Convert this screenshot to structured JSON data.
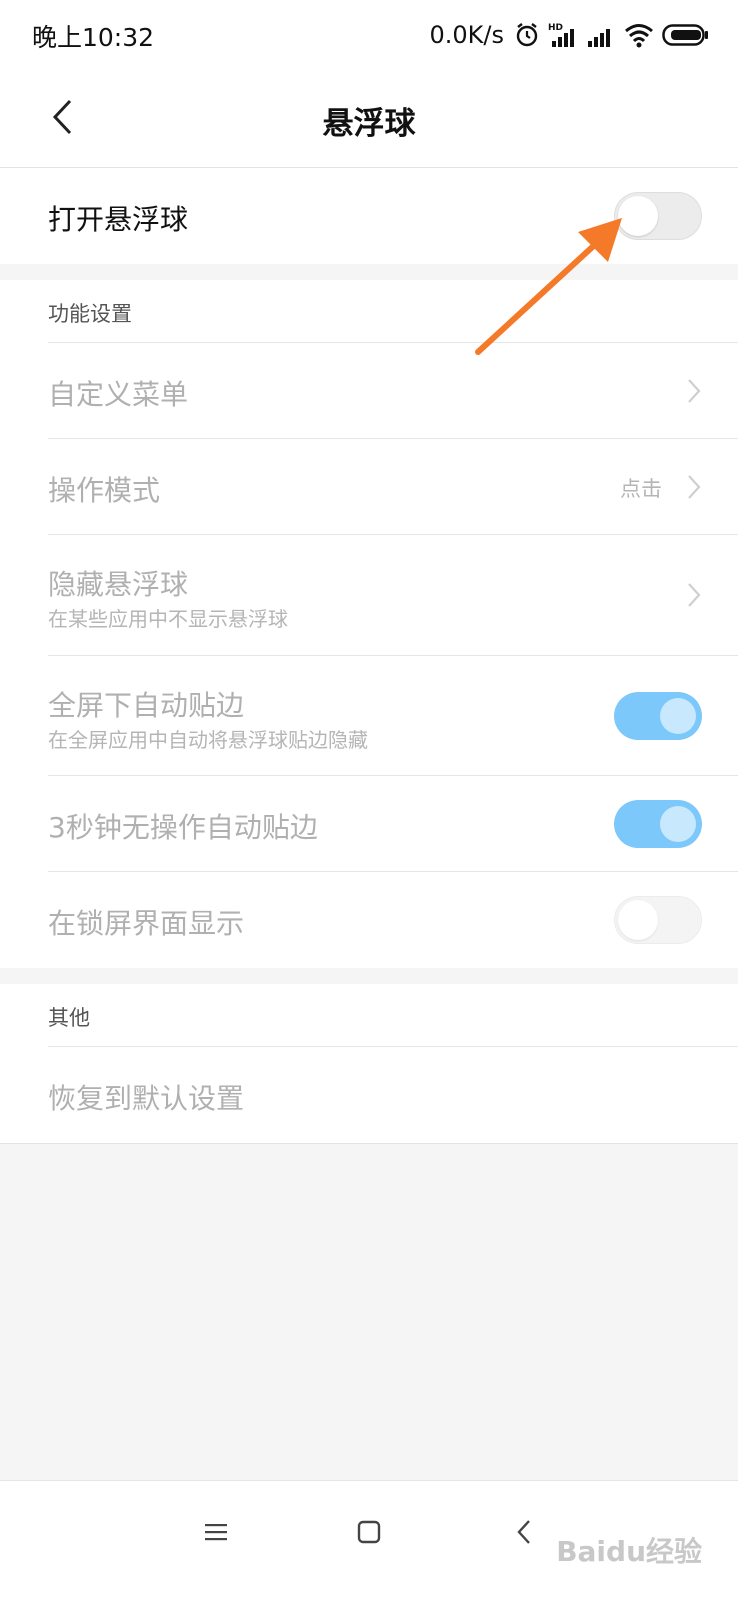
{
  "status_bar": {
    "time": "晚上10:32",
    "net_speed": "0.0K/s",
    "icons": [
      "alarm-icon",
      "hd-signal-icon",
      "signal-icon",
      "wifi-icon",
      "battery-icon"
    ]
  },
  "header": {
    "title": "悬浮球",
    "back_icon": "back-chevron-icon"
  },
  "main_toggle": {
    "label": "打开悬浮球",
    "state": "off"
  },
  "sections": {
    "function_settings": {
      "header": "功能设置",
      "items": [
        {
          "label": "自定义菜单",
          "control": "chevron"
        },
        {
          "label": "操作模式",
          "value": "点击",
          "control": "chevron"
        },
        {
          "label": "隐藏悬浮球",
          "sublabel": "在某些应用中不显示悬浮球",
          "control": "chevron"
        },
        {
          "label": "全屏下自动贴边",
          "sublabel": "在全屏应用中自动将悬浮球贴边隐藏",
          "control": "toggle",
          "state": "on"
        },
        {
          "label": "3秒钟无操作自动贴边",
          "control": "toggle",
          "state": "on"
        },
        {
          "label": "在锁屏界面显示",
          "control": "toggle",
          "state": "off"
        }
      ]
    },
    "other": {
      "header": "其他",
      "items": [
        {
          "label": "恢复到默认设置"
        }
      ]
    }
  },
  "annotation": {
    "arrow_color": "#f47a2a"
  },
  "nav_bar": {
    "icons": [
      "menu-icon",
      "home-icon",
      "back-icon"
    ]
  },
  "watermark": "Baidu经验",
  "colors": {
    "toggle_on": "#7cc8fb",
    "disabled_text": "#b0b0b0"
  }
}
